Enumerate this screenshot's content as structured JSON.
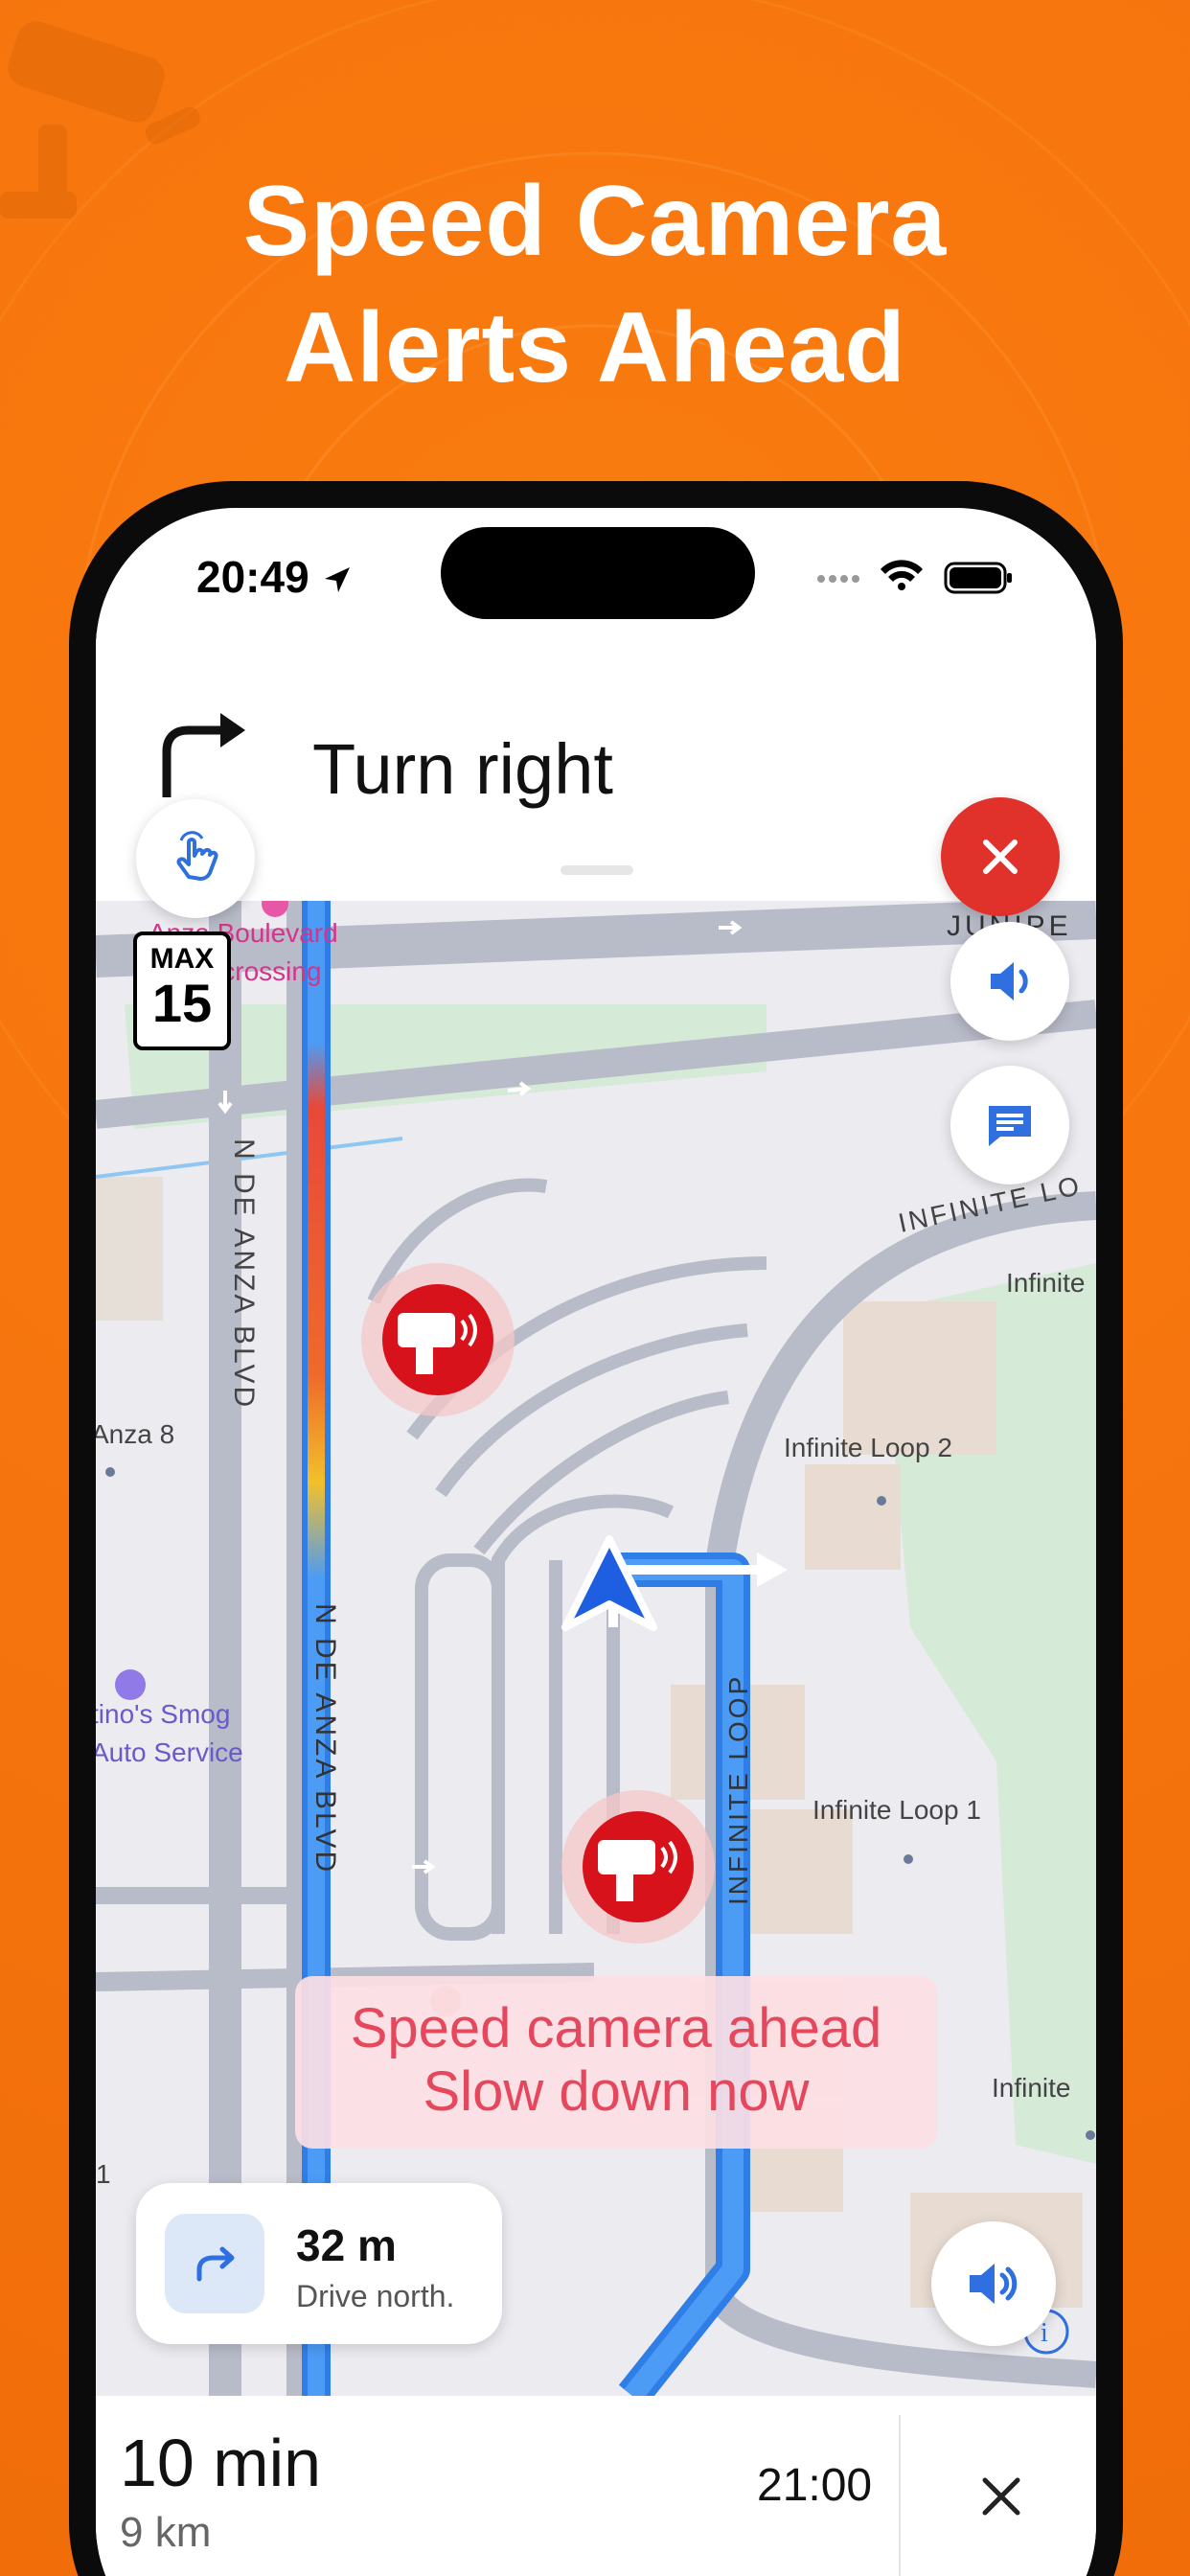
{
  "headline": {
    "line1": "Speed Camera",
    "line2": "Alerts Ahead"
  },
  "status_bar": {
    "time": "20:49",
    "icons": [
      "location-arrow-icon",
      "signal-dots-icon",
      "wifi-icon",
      "battery-icon"
    ]
  },
  "navigation": {
    "maneuver_icon": "turn-right-arrow-icon",
    "instruction": "Turn right"
  },
  "speed_limit": {
    "label": "MAX",
    "value": "15"
  },
  "map_labels": {
    "plaza": "Anza Boulevard",
    "plaza_line2": "Undercrossing",
    "juniper": "JUNIPE",
    "de_anza_left": "N DE ANZA BLVD",
    "de_anza_center": "N DE ANZA BLVD",
    "infinite_loop_road": "INFINITE LOOP",
    "infinite_loop_top": "INFINITE LO",
    "anza8": "Anza 8",
    "infinite_top": "Infinite",
    "loop2": "Infinite Loop 2",
    "loop1": "Infinite Loop 1",
    "infinite_bottom": "Infinite",
    "smog_line1": "tino's Smog",
    "smog_line2": "Auto Service",
    "left_edge": "1"
  },
  "alert": {
    "line1": "Speed camera ahead",
    "line2": "Slow down now"
  },
  "next_maneuver": {
    "distance": "32 m",
    "instruction": "Drive north."
  },
  "trip": {
    "duration": "10 min",
    "distance": "9 km",
    "arrival": "21:00"
  },
  "colors": {
    "brand_orange": "#f7760e",
    "route_blue": "#3b8cf0",
    "camera_red": "#d8121b",
    "close_red": "#e0312a"
  }
}
